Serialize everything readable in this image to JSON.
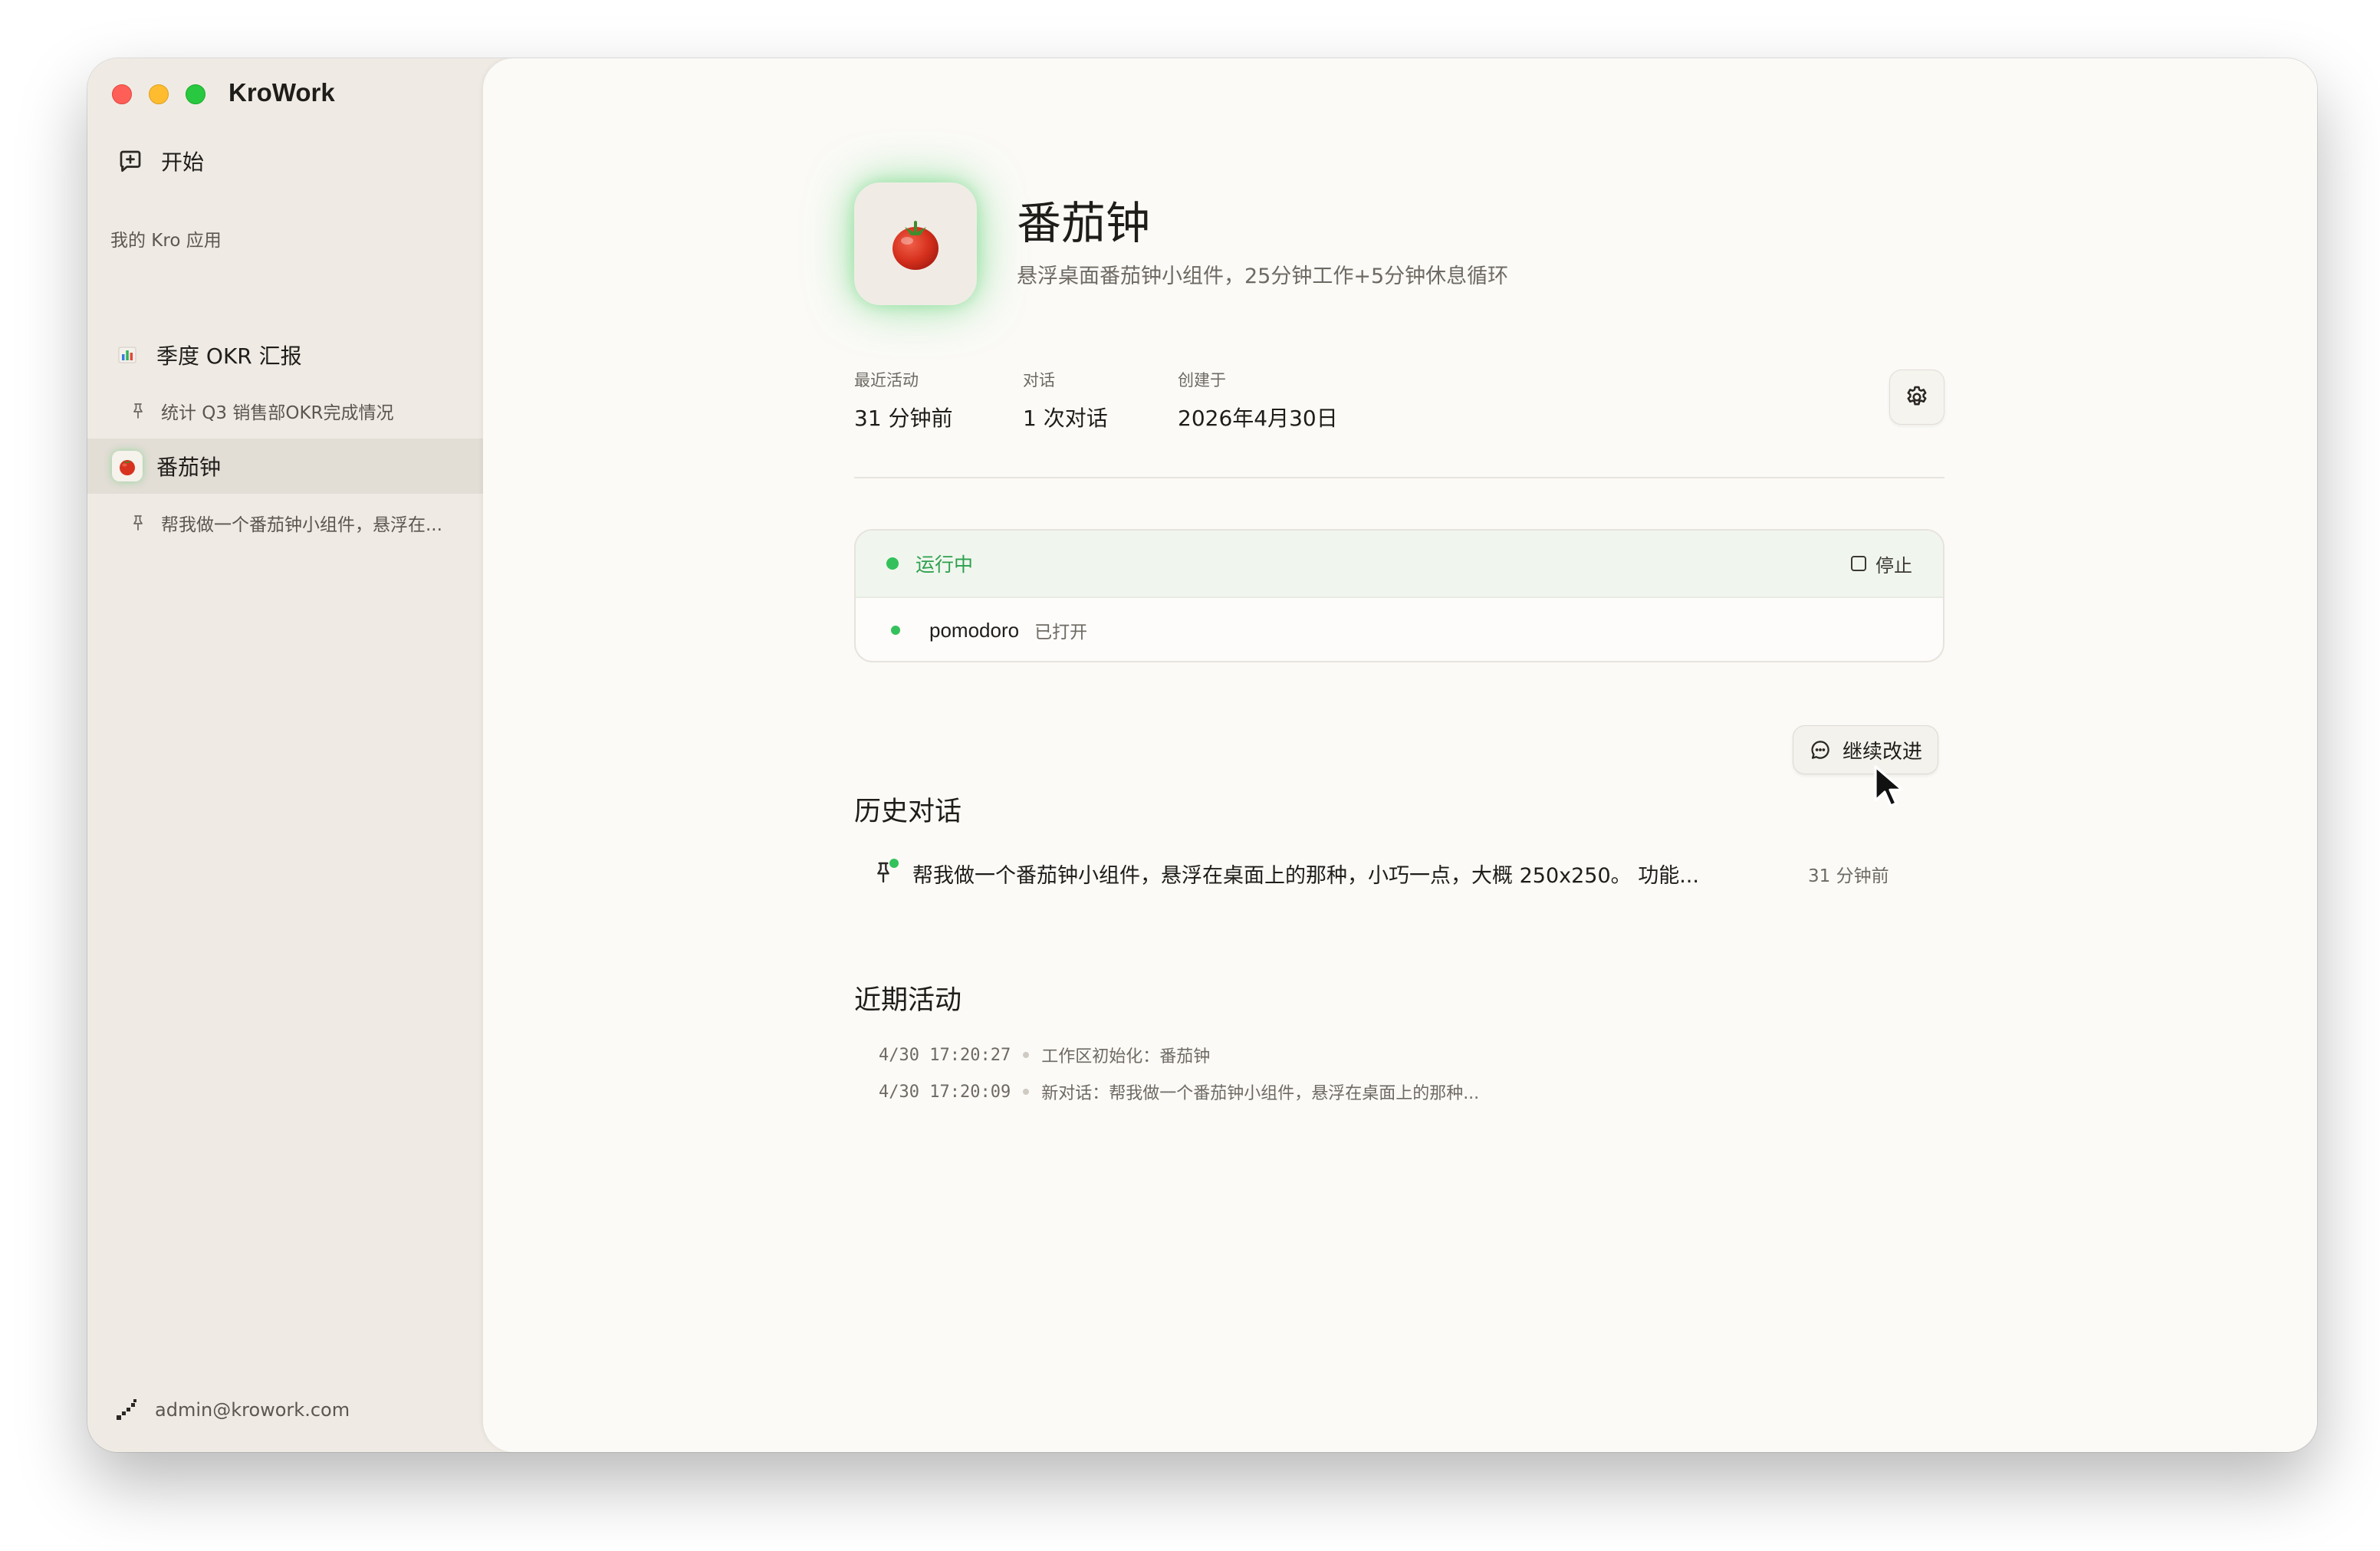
{
  "app": {
    "title": "KroWork"
  },
  "sidebar": {
    "start_label": "开始",
    "section_label": "我的 Kro 应用",
    "items": [
      {
        "label": "季度 OKR 汇报",
        "icon": "bar-chart-icon",
        "sub": "统计 Q3 销售部OKR完成情况"
      },
      {
        "label": "番茄钟",
        "icon": "tomato-icon",
        "sub": "帮我做一个番茄钟小组件，悬浮在..."
      }
    ],
    "user_email": "admin@krowork.com"
  },
  "main": {
    "title": "番茄钟",
    "subtitle": "悬浮桌面番茄钟小组件，25分钟工作+5分钟休息循环",
    "stats": [
      {
        "label": "最近活动",
        "value": "31 分钟前"
      },
      {
        "label": "对话",
        "value": "1 次对话"
      },
      {
        "label": "创建于",
        "value": "2026年4月30日"
      }
    ],
    "run": {
      "status": "运行中",
      "stop_label": "停止",
      "process_name": "pomodoro",
      "process_state": "已打开"
    },
    "history": {
      "title": "历史对话",
      "continue_label": "继续改进",
      "items": [
        {
          "text": "帮我做一个番茄钟小组件，悬浮在桌面上的那种，小巧一点，大概 250x250。 功能...",
          "time": "31 分钟前"
        }
      ]
    },
    "activity": {
      "title": "近期活动",
      "items": [
        {
          "time": "4/30 17:20:27",
          "text": "工作区初始化：番茄钟"
        },
        {
          "time": "4/30 17:20:09",
          "text": "新对话：帮我做一个番茄钟小组件，悬浮在桌面上的那种..."
        }
      ]
    }
  },
  "colors": {
    "accent_green": "#34c15b",
    "status_green": "#2ea04f",
    "sidebar_bg": "#efebe4",
    "main_bg": "#fbfaf7"
  }
}
